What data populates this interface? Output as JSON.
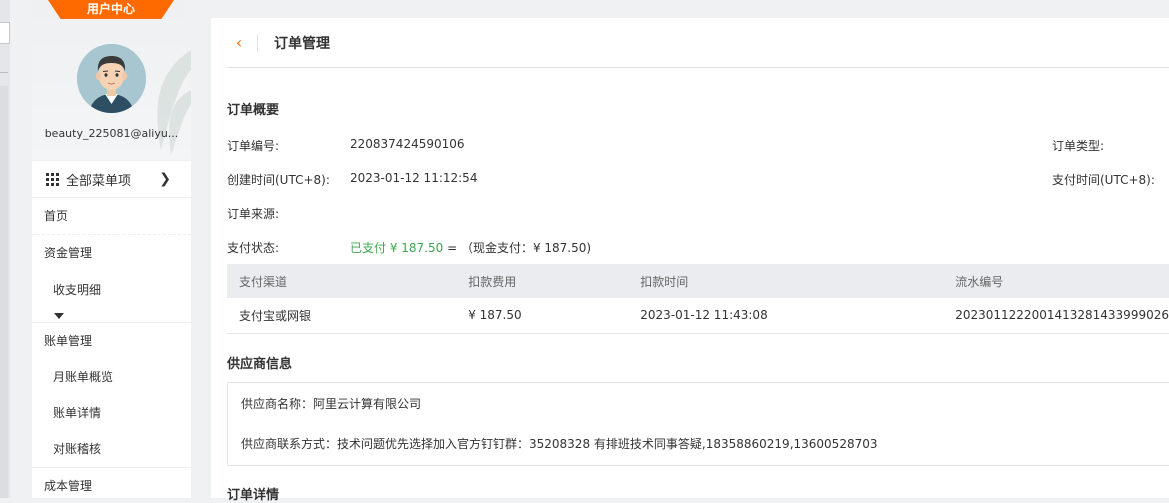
{
  "sidebar": {
    "user_center_tab": "用户中心",
    "username": "beauty_225081@aliyu...",
    "all_menu_label": "全部菜单项",
    "nav": {
      "home": "首页",
      "funds": "资金管理",
      "income_expense": "收支明细",
      "bills": "账单管理",
      "monthly_overview": "月账单概览",
      "bill_details": "账单详情",
      "reconciliation": "对账稽核",
      "cost": "成本管理"
    }
  },
  "page": {
    "title": "订单管理"
  },
  "overview": {
    "title": "订单概要",
    "order_no_label": "订单编号:",
    "order_no": "220837424590106",
    "order_type_label": "订单类型:",
    "created_label": "创建时间(UTC+8):",
    "created": "2023-01-12 11:12:54",
    "paid_time_label": "支付时间(UTC+8):",
    "source_label": "订单来源:",
    "pay_status_label": "支付状态:",
    "pay_status_paid": "已支付 ¥ 187.50",
    "pay_status_detail": " = （现金支付：¥ 187.50)"
  },
  "payments": {
    "columns": [
      "支付渠道",
      "扣款费用",
      "扣款时间",
      "流水编号"
    ],
    "rows": [
      [
        "支付宝或网银",
        "¥ 187.50",
        "2023-01-12 11:43:08",
        "2023011222001413281433999026"
      ]
    ]
  },
  "supplier": {
    "title": "供应商信息",
    "name_line": "供应商名称：阿里云计算有限公司",
    "contact_line": "供应商联系方式：技术问题优先选择加入官方钉钉群：35208328 有排班技术同事答疑,18358860219,13600528703"
  },
  "details": {
    "title": "订单详情"
  },
  "colors": {
    "accent": "#ff6a00",
    "paid_green": "#3ea64f",
    "table_header_bg": "#eaecef"
  }
}
